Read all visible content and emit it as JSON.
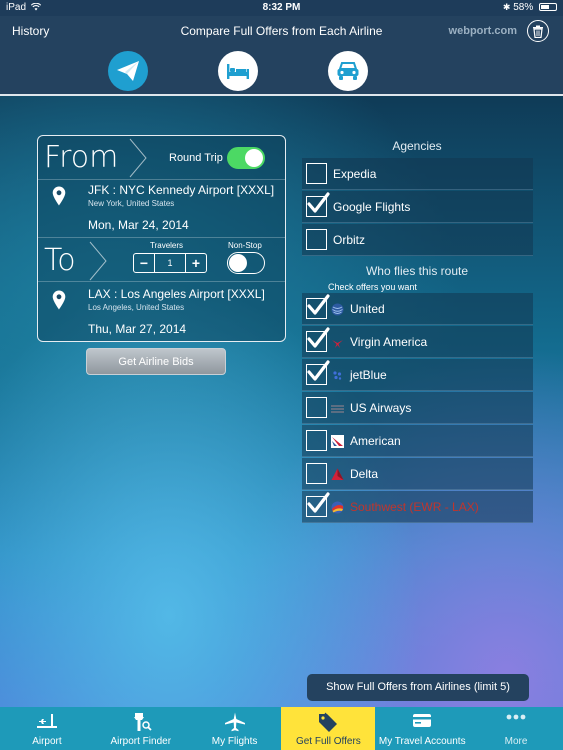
{
  "status_bar": {
    "carrier": "iPad",
    "time": "8:32 PM",
    "battery": "58%",
    "battery_level": 0.58
  },
  "header": {
    "history_label": "History",
    "title": "Compare Full Offers from Each Airline",
    "brand": "webport.com",
    "modes": [
      {
        "name": "flight",
        "icon": "paper-plane-icon",
        "active": true
      },
      {
        "name": "hotel",
        "icon": "bed-icon",
        "active": false
      },
      {
        "name": "car",
        "icon": "car-icon",
        "active": false
      }
    ]
  },
  "trip": {
    "from_label": "From",
    "to_label": "To",
    "round_trip_label": "Round Trip",
    "round_trip_on": true,
    "origin": {
      "airport": "JFK : NYC Kennedy Airport [XXXL]",
      "city": "New York, United States",
      "date": "Mon, Mar 24, 2014"
    },
    "destination": {
      "airport": "LAX : Los Angeles Airport [XXXL]",
      "city": "Los Angeles, United States",
      "date": "Thu, Mar 27, 2014"
    },
    "travelers_label": "Travelers",
    "travelers": "1",
    "minus": "−",
    "plus": "+",
    "nonstop_label": "Non-Stop",
    "nonstop_on": false,
    "bids_button": "Get Airline Bids"
  },
  "agencies": {
    "title": "Agencies",
    "items": [
      {
        "label": "Expedia",
        "checked": false
      },
      {
        "label": "Google Flights",
        "checked": true
      },
      {
        "label": "Orbitz",
        "checked": false
      }
    ]
  },
  "airlines": {
    "title": "Who flies this route",
    "subtitle": "Check offers you want",
    "items": [
      {
        "label": "United",
        "checked": true,
        "logo": "united-logo-icon",
        "highlight": false
      },
      {
        "label": "Virgin America",
        "checked": true,
        "logo": "virgin-america-logo-icon",
        "highlight": false
      },
      {
        "label": "jetBlue",
        "checked": true,
        "logo": "jetblue-logo-icon",
        "highlight": false
      },
      {
        "label": "US Airways",
        "checked": false,
        "logo": "us-airways-logo-icon",
        "highlight": false
      },
      {
        "label": "American",
        "checked": false,
        "logo": "american-logo-icon",
        "highlight": false
      },
      {
        "label": "Delta",
        "checked": false,
        "logo": "delta-logo-icon",
        "highlight": false
      },
      {
        "label": "Southwest (EWR - LAX)",
        "checked": true,
        "logo": "southwest-logo-icon",
        "highlight": true
      }
    ]
  },
  "show_button": "Show Full Offers from Airlines (limit 5)",
  "tabs": [
    {
      "label": "Airport",
      "icon": "runway-icon",
      "active": false
    },
    {
      "label": "Airport Finder",
      "icon": "tower-search-icon",
      "active": false
    },
    {
      "label": "My Flights",
      "icon": "airplane-icon",
      "active": false
    },
    {
      "label": "Get Full Offers",
      "icon": "price-tag-icon",
      "active": true
    },
    {
      "label": "My Travel Accounts",
      "icon": "card-icon",
      "active": false
    },
    {
      "label": "More",
      "icon": "more-dots-icon",
      "active": false
    }
  ],
  "colors": {
    "header_bg": "#24425f",
    "accent_blue": "#1f9fd0",
    "toggle_on": "#4cd964",
    "tab_bar": "#1e9ab9",
    "tab_active": "#ffe33a",
    "southwest_red": "#c0352d"
  }
}
